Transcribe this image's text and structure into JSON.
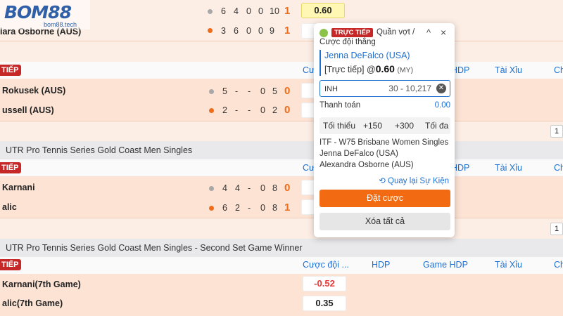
{
  "logo": {
    "brand": "BOM88",
    "site": "bom88.tech"
  },
  "top_match": {
    "player1": "lara Osborne (AUS)",
    "scores1": [
      "6",
      "4",
      "0",
      "0",
      "10",
      "1"
    ],
    "scores2": [
      "3",
      "6",
      "0",
      "0",
      "9",
      "1"
    ],
    "odds1": "0.60",
    "odds2": "-"
  },
  "section1": {
    "live_label": "TIẾP",
    "columns": [
      "Cược",
      "HDP",
      "Tài Xỉu",
      "Ch"
    ],
    "player1": "Rokusek (AUS)",
    "player2": "ussell (AUS)",
    "scores1": [
      "5",
      "-",
      "-",
      "0",
      "5",
      "0"
    ],
    "scores2": [
      "2",
      "-",
      "-",
      "0",
      "2",
      "0"
    ],
    "odds": "-",
    "page": "1"
  },
  "section2": {
    "league": "UTR Pro Tennis Series Gold Coast Men Singles",
    "live_label": "TIẾP",
    "columns": [
      "Cược",
      "HDP",
      "Tài Xỉu",
      "Ch"
    ],
    "player1": "Karnani",
    "player2": "alic",
    "scores1": [
      "4",
      "4",
      "-",
      "0",
      "8",
      "0"
    ],
    "scores2": [
      "6",
      "2",
      "-",
      "0",
      "8",
      "1"
    ],
    "odds": "-",
    "page": "1"
  },
  "section3": {
    "league": "UTR Pro Tennis Series Gold Coast Men Singles - Second Set Game Winner",
    "live_label": "TIẾP",
    "columns": [
      "Cược đội ...",
      "HDP",
      "Game HDP",
      "Tài Xỉu",
      "Ch"
    ],
    "player1": "Karnani(7th Game)",
    "player2": "alic(7th Game)",
    "odds1": "-0.52",
    "odds2": "0.35"
  },
  "betslip": {
    "live_badge": "TRỰC TIẾP",
    "title_line1": "Quần vợt /",
    "title_line2": "Cược đội thắng",
    "chevron": "^",
    "close": "×",
    "team": "Jenna DeFalco (USA)",
    "bet_prefix": "[Trực tiếp] @",
    "bet_odds": "0.60",
    "odds_format": "(MY)",
    "stake_value": "INH",
    "stake_range": "30 - 10,217",
    "payout_label": "Thanh toán",
    "payout_value": "0.00",
    "quick": [
      "Tối thiểu",
      "+150",
      "+300",
      "Tối đa"
    ],
    "event_lines": [
      "ITF - W75 Brisbane Women Singles",
      "Jenna DeFalco (USA)",
      "Alexandra Osborne (AUS)"
    ],
    "back_label": "Quay lại Sự Kiện",
    "place_bet": "Đặt cược",
    "remove_all": "Xóa tất cả"
  }
}
